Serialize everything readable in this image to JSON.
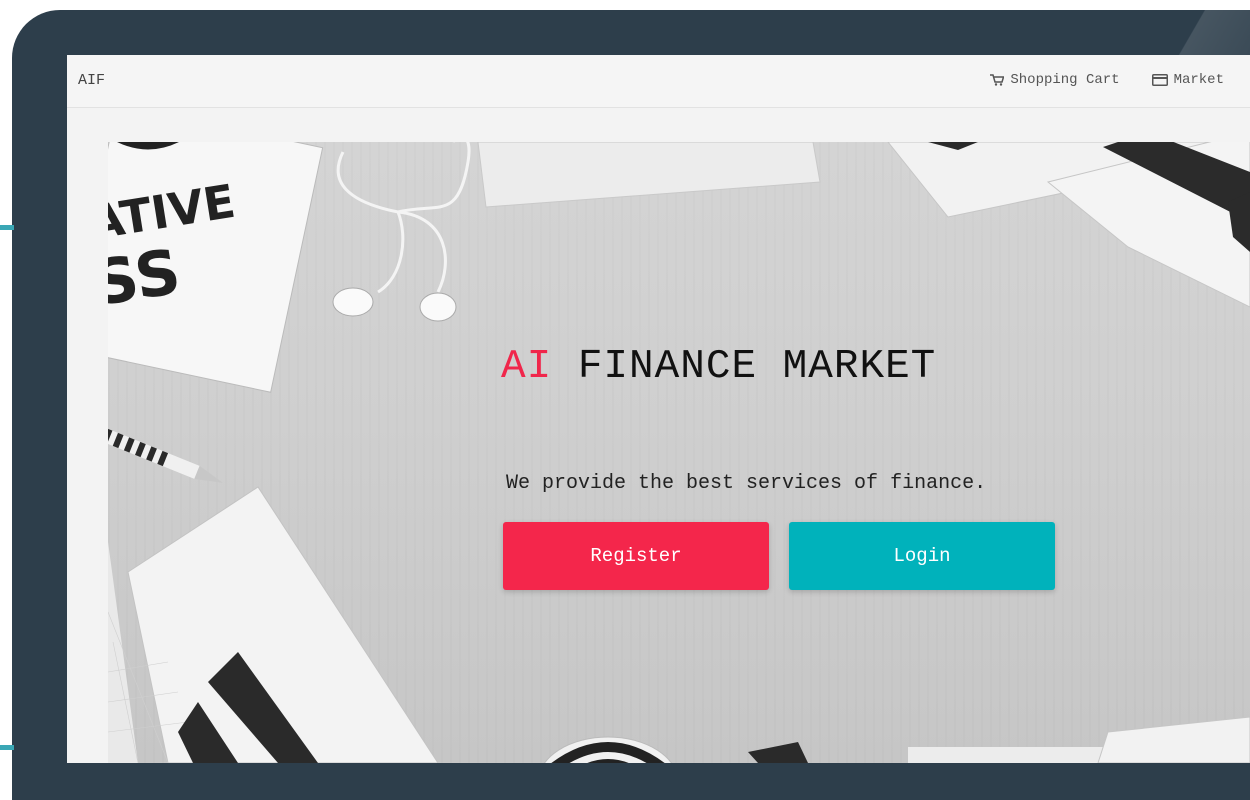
{
  "app": {
    "brand": "AIF"
  },
  "nav": {
    "items": [
      {
        "label": "Shopping Cart",
        "icon": "cart-icon"
      },
      {
        "label": "Market",
        "icon": "card-icon"
      }
    ]
  },
  "hero": {
    "title_accent": "AI",
    "title_rest": " FINANCE MARKET",
    "tagline": "We provide the best services of finance.",
    "buttons": {
      "register_label": "Register",
      "login_label": "Login"
    },
    "background_text": {
      "line1": "ATIVE",
      "line2": "SS"
    }
  },
  "colors": {
    "frame": "#2d3e4b",
    "accent_red": "#f4264b",
    "accent_teal": "#00b2bb",
    "navbar_bg": "#f5f5f5"
  }
}
